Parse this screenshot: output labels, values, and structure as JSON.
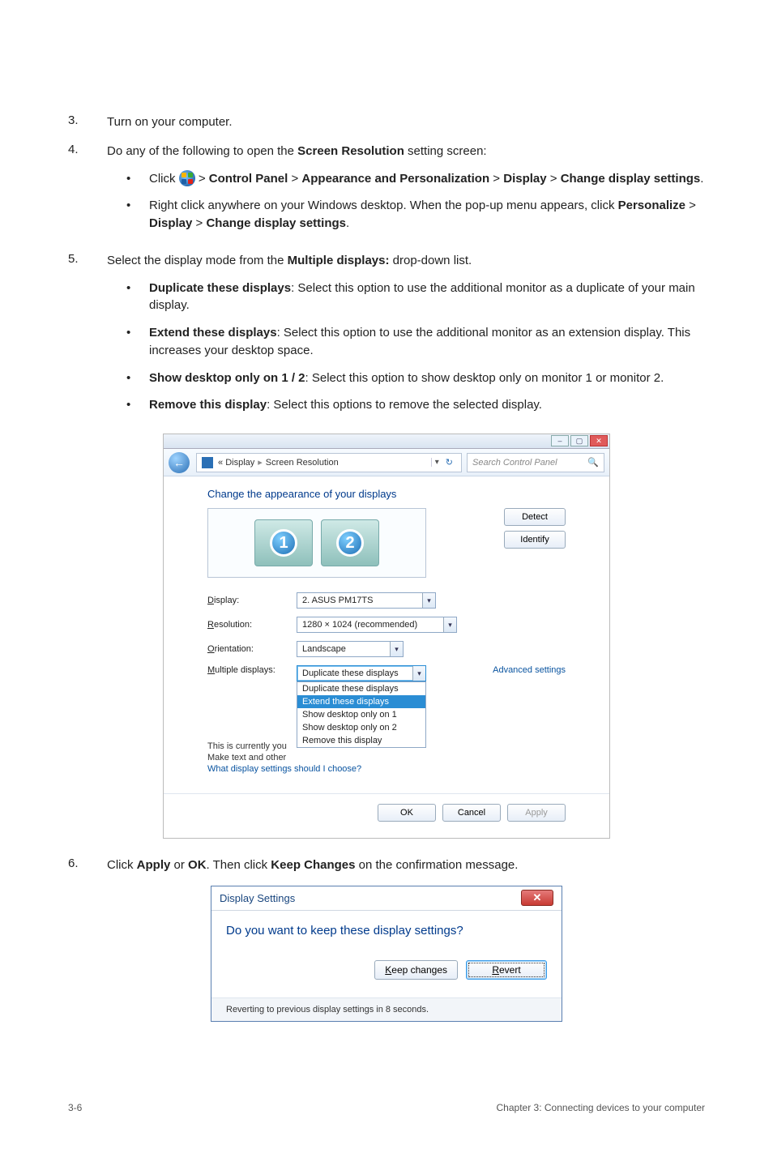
{
  "steps": {
    "s3": {
      "num": "3.",
      "text": "Turn on your computer."
    },
    "s4": {
      "num": "4.",
      "lead_a": "Do any of the following to open the ",
      "lead_bold": "Screen Resolution",
      "lead_b": " setting screen:",
      "bullets": {
        "b1": {
          "pre": "Click ",
          "seq": [
            " > ",
            "Control Panel",
            " > ",
            "Appearance and Personalization",
            " > ",
            "Display",
            " > ",
            "Change display settings",
            "."
          ]
        },
        "b2": {
          "text_a": "Right click anywhere on your Windows desktop. When the pop-up menu appears, click ",
          "seq": [
            "Personalize",
            " > ",
            "Display",
            " > ",
            "Change display settings",
            "."
          ]
        }
      }
    },
    "s5": {
      "num": "5.",
      "lead_a": "Select the display mode from the ",
      "lead_bold": "Multiple displays:",
      "lead_b": " drop-down list.",
      "bullets": {
        "b1": {
          "title": "Duplicate these displays",
          "rest": ": Select this option to use the additional monitor as a duplicate of your main display."
        },
        "b2": {
          "title": "Extend these displays",
          "rest": ": Select this option to use the additional monitor as an extension display. This increases your desktop space."
        },
        "b3": {
          "title": "Show desktop only on 1 / 2",
          "rest": ": Select this option to show desktop only on monitor 1 or monitor 2."
        },
        "b4": {
          "title": "Remove this display",
          "rest": ": Select this options to remove the selected display."
        }
      }
    },
    "s6": {
      "num": "6.",
      "a": "Click ",
      "b1": "Apply",
      "mid": " or ",
      "b2": "OK",
      "c": ". Then click ",
      "b3": "Keep Changes",
      "d": " on the confirmation message."
    }
  },
  "sr": {
    "breadcrumb": {
      "left": "«",
      "display": "Display",
      "arrow": "▸",
      "screen_res": "Screen Resolution"
    },
    "search_placeholder": "Search Control Panel",
    "title": "Change the appearance of your displays",
    "monitors": {
      "m1": "1",
      "m2": "2"
    },
    "buttons": {
      "detect": "Detect",
      "identify": "Identify"
    },
    "fields": {
      "display_label": "Display:",
      "display_value": "2. ASUS PM17TS",
      "resolution_label": "Resolution:",
      "resolution_value": "1280 × 1024 (recommended)",
      "orientation_label": "Orientation:",
      "orientation_value": "Landscape",
      "multiple_label": "Multiple displays:",
      "multiple_value": "Duplicate these displays"
    },
    "mult_menu": {
      "o1": "Duplicate these displays",
      "o2": "Extend these displays",
      "o3": "Show desktop only on 1",
      "o4": "Show desktop only on 2",
      "o5": "Remove this display"
    },
    "overlays": {
      "row1_pre": "This is currently you",
      "row2_pre": "Make text and other",
      "row3": "What display settings should I choose?"
    },
    "advanced": "Advanced settings",
    "footer": {
      "ok": "OK",
      "cancel": "Cancel",
      "apply": "Apply"
    }
  },
  "ds": {
    "title": "Display Settings",
    "question": "Do you want to keep these display settings?",
    "keep_u": "K",
    "keep_rest": "eep changes",
    "revert_u": "R",
    "revert_rest": "evert",
    "footer": "Reverting to previous display settings in 8 seconds."
  },
  "footer": {
    "page": "3-6",
    "chapter": "Chapter 3: Connecting devices to your computer"
  }
}
